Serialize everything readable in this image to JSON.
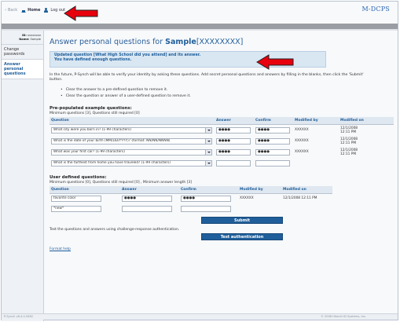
{
  "topbar": {
    "back": "Back",
    "home": "Home",
    "logout": "Log out",
    "brand": "M-DCPS"
  },
  "sidebar": {
    "id_label": "ID:",
    "id_value": "xxxxxxxx",
    "name_label": "Name:",
    "name_value": "Sample",
    "items": [
      {
        "label": "Change passwords"
      },
      {
        "label": "Answer personal questions"
      }
    ]
  },
  "page": {
    "title_prefix": "Answer personal questions for",
    "title_name": "Sample",
    "title_id": "[XXXXXXXX]"
  },
  "notice": {
    "line1": "Updated question [What High School did you attend] and its answer.",
    "line2": "You have defined enough questions."
  },
  "intro": "In the future, P-Synch will be able to verify your identity by asking these questions. Add secret personal questions and answers by filling in the blanks, then click the 'Submit' button.",
  "bullets": [
    "Clear the answer to a pre-defined question to remove it.",
    "Clear the question or answer of a user-defined question to remove it."
  ],
  "prepop": {
    "heading": "Pre-populated example questions:",
    "sub": "Minimum questions [3], Questions still required [0]",
    "columns": [
      "Question",
      "Answer",
      "Confirm",
      "Modified by",
      "Modified on"
    ],
    "rows": [
      {
        "question": "What city were you born in? (1-99 characters)",
        "answer": "●●●●",
        "confirm": "●●●●",
        "modified_by": "XXXXXX",
        "date": "12/1/2008",
        "time": "12:11 PM"
      },
      {
        "question": "What is the date of your birth (MM/DD/YYYY)? (format: NN/NN/NNNN)",
        "answer": "●●●●",
        "confirm": "●●●●",
        "modified_by": "XXXXXX",
        "date": "12/1/2008",
        "time": "12:11 PM"
      },
      {
        "question": "What was your first car? (1-99 characters)",
        "answer": "●●●●",
        "confirm": "●●●●",
        "modified_by": "XXXXXX",
        "date": "12/1/2008",
        "time": "12:11 PM"
      },
      {
        "question": "What is the farthest from home you have traveled? (1-99 characters)",
        "answer": "",
        "confirm": "",
        "modified_by": "",
        "date": "",
        "time": ""
      }
    ]
  },
  "userdef": {
    "heading": "User defined questions:",
    "sub": "Minimum questions [0], Questions still required [0] , Minimum answer length [3]",
    "columns": [
      "Question",
      "Answer",
      "Confirm",
      "Modified by",
      "Modified on"
    ],
    "rows": [
      {
        "question": "favorite color",
        "answer": "●●●●",
        "confirm": "●●●●",
        "modified_by": "XXXXXX",
        "modified_on": "12/1/2008 12:11 PM"
      },
      {
        "question": "*new*",
        "answer": "",
        "confirm": "",
        "modified_by": "",
        "modified_on": ""
      }
    ]
  },
  "buttons": {
    "submit": "Submit",
    "test": "Test authentication"
  },
  "test_note": "Test the questions and answers using challenge-response authentication.",
  "format_help": "Format help",
  "footer": {
    "left": "P-Synch v6.4.0.3482",
    "right": "© 2008 Hitachi ID Systems, Inc."
  },
  "colors": {
    "accent": "#1f5e9a",
    "arrow": "#e8000d"
  }
}
